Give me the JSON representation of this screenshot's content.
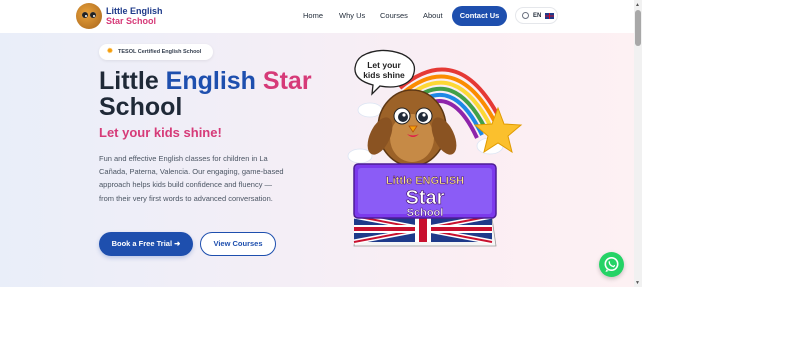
{
  "brand": {
    "name_line1": "Little English",
    "name_line2": "Star School",
    "blue": "#1e4fae",
    "pink": "#d63a78"
  },
  "nav": {
    "links": [
      "Home",
      "Why Us",
      "Courses",
      "About"
    ],
    "contact_label": "Contact Us",
    "language_code": "EN"
  },
  "hero": {
    "badge": "TESOL Certified English School",
    "title": {
      "word1": "Little",
      "word2": "English",
      "word3": "Star",
      "word4": "School"
    },
    "tagline": "Let your kids shine!",
    "description": "Fun and effective English classes for children in La Cañada, Paterna, Valencia. Our engaging, game-based approach helps kids build confidence and fluency — from their very first words to advanced conversation.",
    "primary_cta": "Book a Free Trial ➜",
    "secondary_cta": "View Courses"
  },
  "illustration": {
    "speech_bubble": "Let your kids shine",
    "book_line1": "Little ENGLISH",
    "book_line2": "Star",
    "book_line3": "School"
  },
  "icons": {
    "whatsapp": "whatsapp-icon",
    "globe": "globe-icon",
    "flag": "uk-flag-icon",
    "badge_star": "sparkle-icon"
  }
}
